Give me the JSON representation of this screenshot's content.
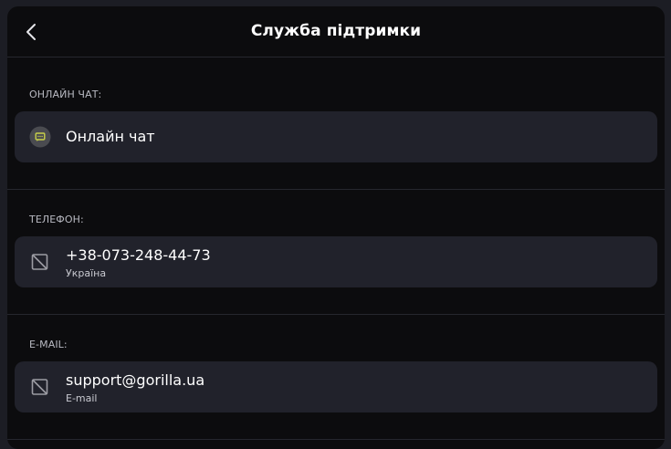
{
  "header": {
    "title": "Служба підтримки"
  },
  "sections": [
    {
      "label": "ОНЛАЙН ЧАТ:",
      "card": {
        "icon": "chat-icon",
        "main": "Онлайн чат",
        "sub": ""
      }
    },
    {
      "label": "ТЕЛЕФОН:",
      "card": {
        "icon": "broken-image-icon",
        "main": "+38-073-248-44-73",
        "sub": "Україна"
      }
    },
    {
      "label": "E-MAIL:",
      "card": {
        "icon": "broken-image-icon",
        "main": "support@gorilla.ua",
        "sub": "E-mail"
      }
    }
  ],
  "colors": {
    "background": "#0c0c0e",
    "card": "#21222b",
    "chat_icon_accent": "#c9d14a"
  }
}
